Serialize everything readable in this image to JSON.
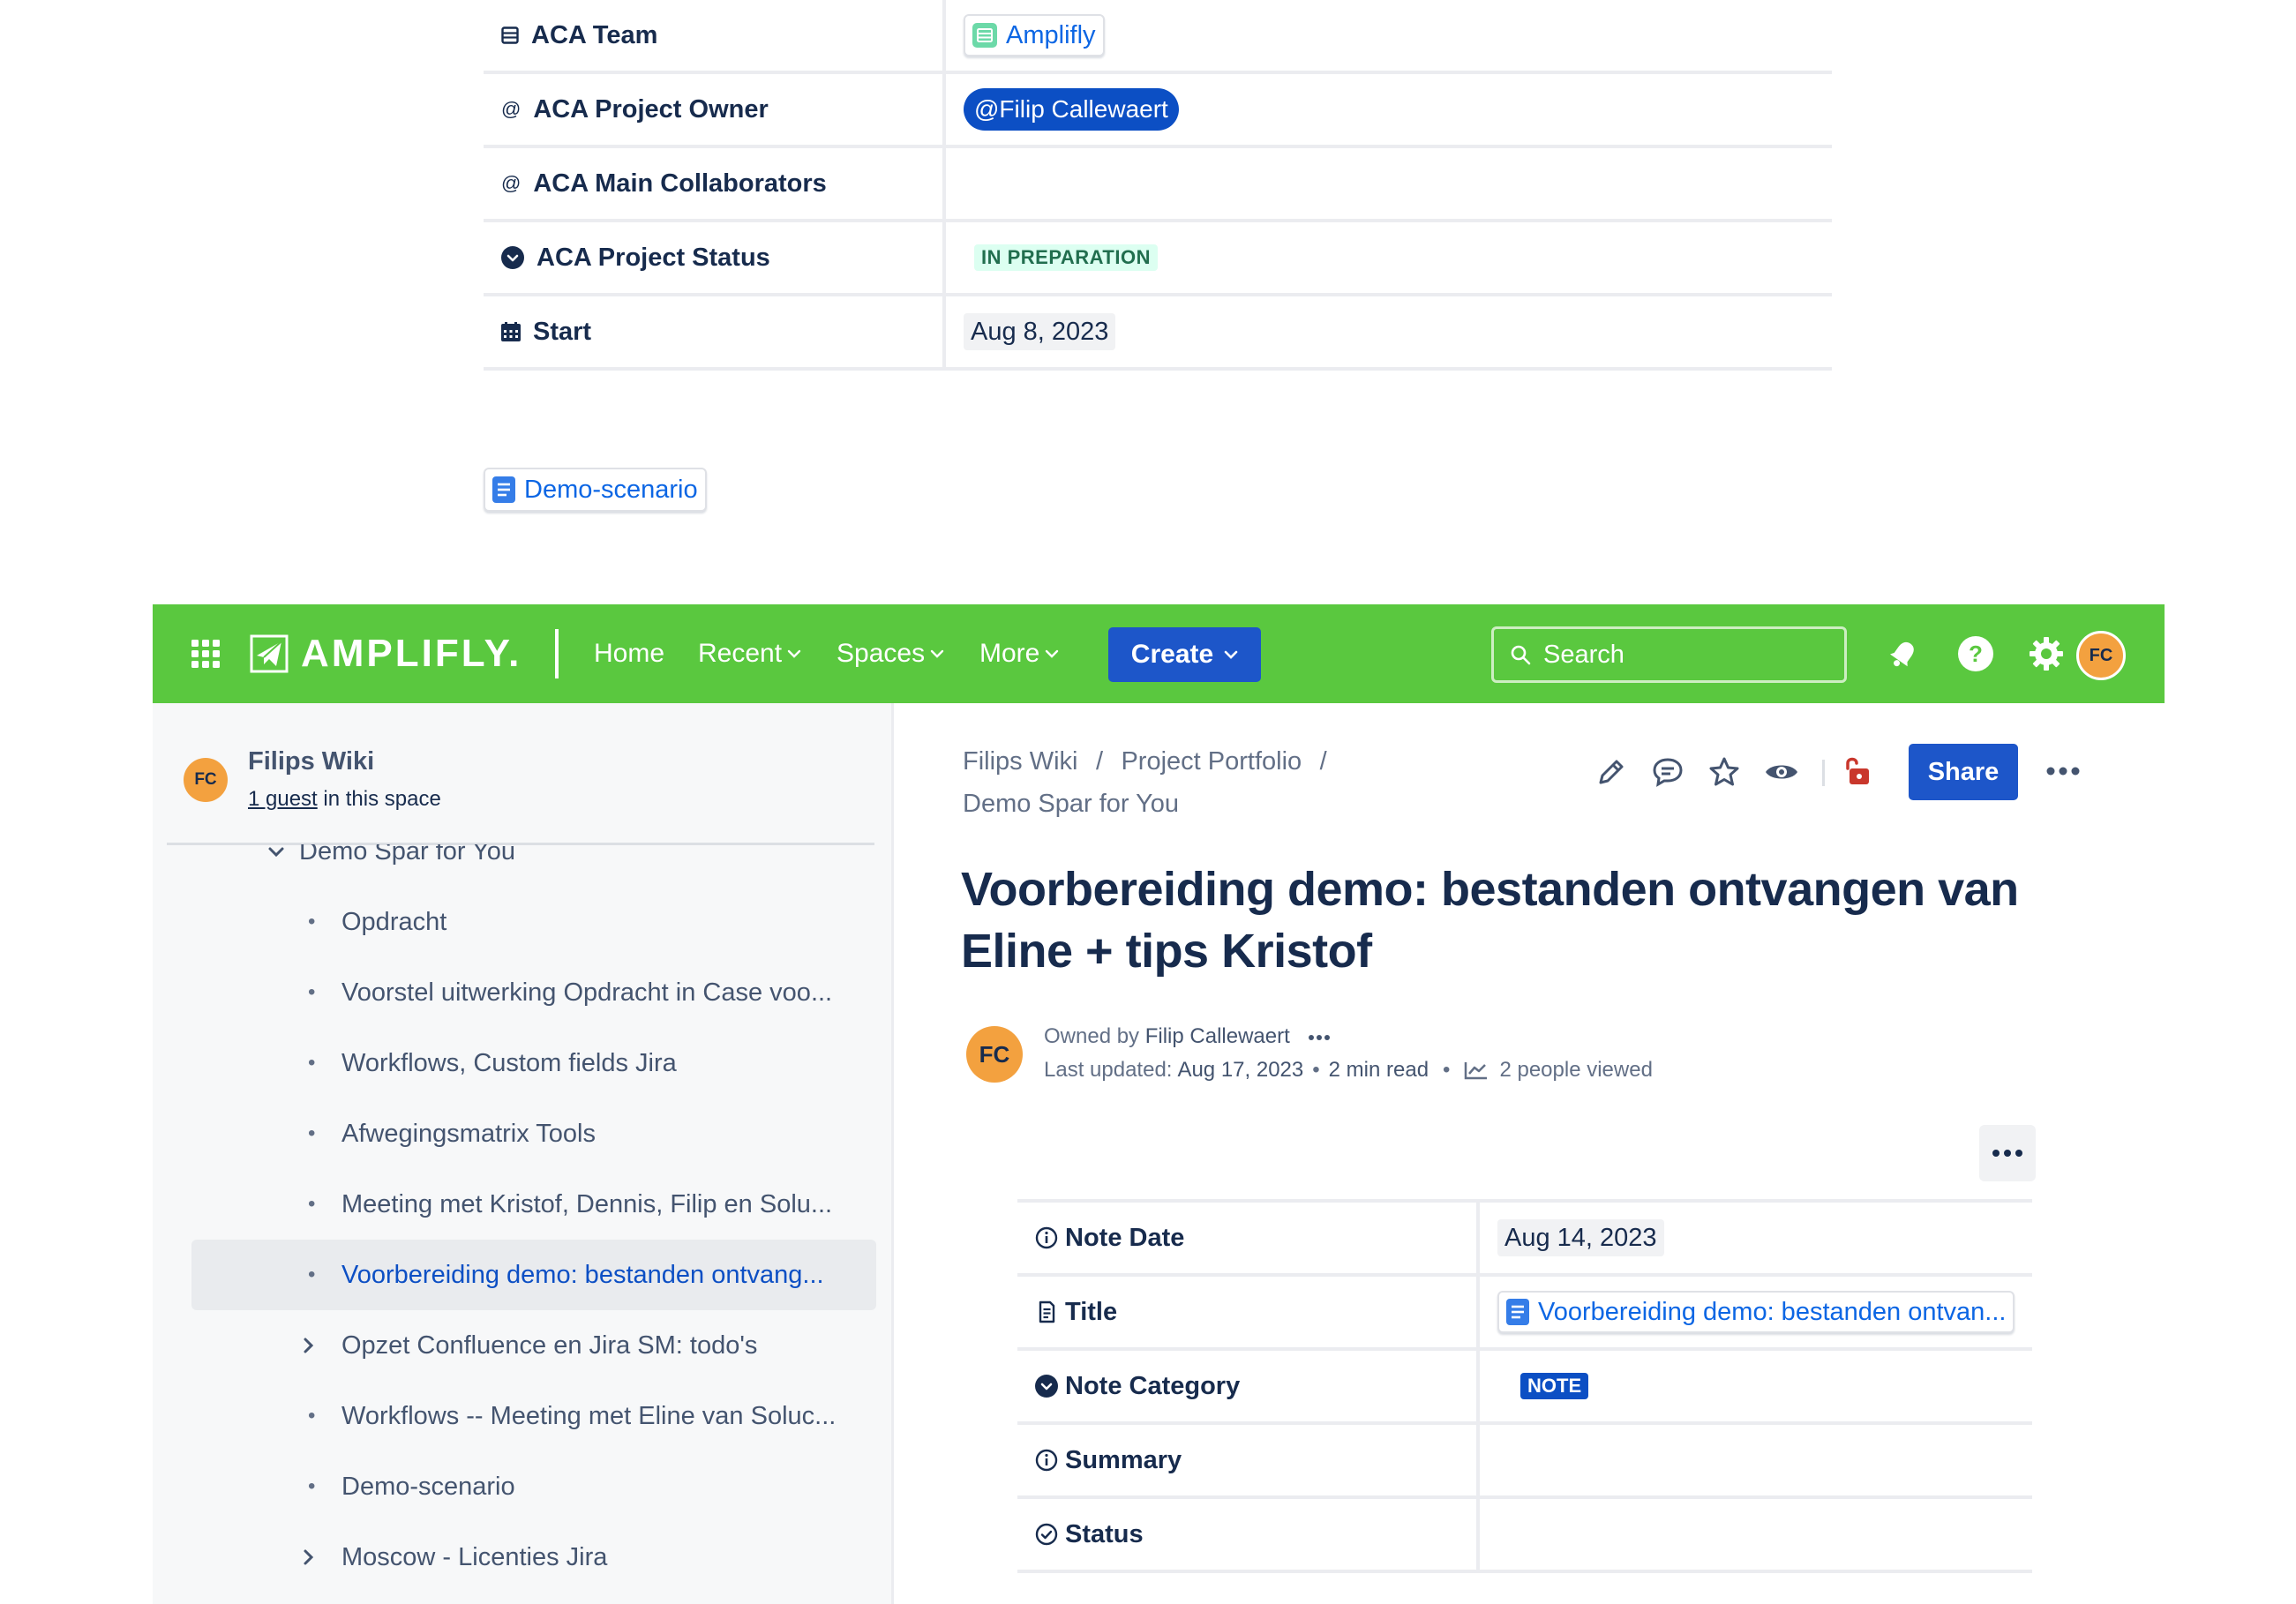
{
  "top_properties": {
    "rows": [
      {
        "key": "ACA Team",
        "value": "Amplifly"
      },
      {
        "key": "ACA Project Owner",
        "value": "@Filip Callewaert"
      },
      {
        "key": "ACA Main Collaborators",
        "value": ""
      },
      {
        "key": "ACA Project Status",
        "value": "IN PREPARATION"
      },
      {
        "key": "Start",
        "value": "Aug 8, 2023"
      }
    ],
    "linked_page": "Demo-scenario"
  },
  "header": {
    "logo_text": "AMPLIFLY.",
    "nav": [
      "Home",
      "Recent",
      "Spaces",
      "More"
    ],
    "create_label": "Create",
    "search_placeholder": "Search",
    "avatar_initials": "FC",
    "colors": {
      "bar": "#5ac83f",
      "create": "#1d56c9"
    }
  },
  "sidebar": {
    "space_name": "Filips Wiki",
    "guest_link": "1 guest",
    "guest_suffix": " in this space",
    "avatar_initials": "FC",
    "parent_item": "Demo Spar for You",
    "items": [
      {
        "label": "Opdracht",
        "marker": "bullet"
      },
      {
        "label": "Voorstel uitwerking Opdracht in Case voo...",
        "marker": "bullet"
      },
      {
        "label": "Workflows, Custom fields Jira",
        "marker": "bullet"
      },
      {
        "label": "Afwegingsmatrix Tools",
        "marker": "bullet"
      },
      {
        "label": "Meeting met Kristof, Dennis, Filip en Solu...",
        "marker": "bullet"
      },
      {
        "label": "Voorbereiding demo: bestanden ontvang...",
        "marker": "bullet",
        "active": true
      },
      {
        "label": "Opzet Confluence en Jira SM: todo's",
        "marker": "chevron"
      },
      {
        "label": "Workflows -- Meeting met Eline van Soluc...",
        "marker": "bullet"
      },
      {
        "label": "Demo-scenario",
        "marker": "bullet"
      },
      {
        "label": "Moscow - Licenties Jira",
        "marker": "chevron"
      }
    ]
  },
  "main": {
    "breadcrumb": [
      "Filips Wiki",
      "Project Portfolio",
      "Demo Spar for You"
    ],
    "share_label": "Share",
    "title": "Voorbereiding demo: bestanden ontvangen van Eline + tips Kristof",
    "byline": {
      "owned_by_prefix": "Owned by",
      "owner": "Filip Callewaert",
      "updated_prefix": "Last updated:",
      "updated_date": "Aug 17, 2023",
      "read_time": "2 min read",
      "viewers": "2 people viewed",
      "avatar_initials": "FC"
    },
    "properties": [
      {
        "key": "Note Date",
        "icon": "info-circle-icon",
        "value": "Aug 14, 2023"
      },
      {
        "key": "Title",
        "icon": "page-icon",
        "value": "Voorbereiding demo: bestanden ontvan..."
      },
      {
        "key": "Note Category",
        "icon": "dropdown-circle-icon",
        "value": "NOTE"
      },
      {
        "key": "Summary",
        "icon": "info-circle-icon",
        "value": ""
      },
      {
        "key": "Status",
        "icon": "check-circle-icon",
        "value": ""
      }
    ]
  }
}
